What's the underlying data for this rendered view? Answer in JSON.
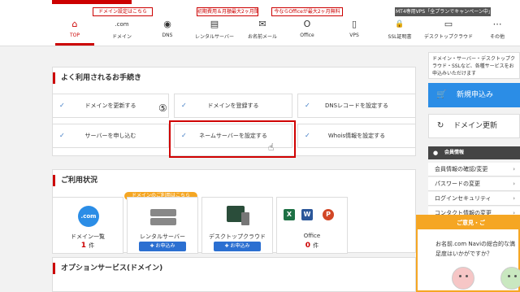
{
  "promos": [
    "ドメイン設定はこちら",
    "初期費用＆月額最大2ヶ月間無料！",
    "今ならOfficeが最大2ヶ月無料",
    "MT4専用VPS「全プランでキャンペーン中」"
  ],
  "nav": [
    {
      "label": "TOP",
      "icon": "home-icon",
      "glyph": "⌂"
    },
    {
      "label": "ドメイン",
      "icon": "domain-icon",
      "glyph": ".com"
    },
    {
      "label": "DNS",
      "icon": "dns-icon",
      "glyph": "◉"
    },
    {
      "label": "レンタルサーバー",
      "icon": "server-icon",
      "glyph": "▤"
    },
    {
      "label": "お名前メール",
      "icon": "mail-icon",
      "glyph": "✉"
    },
    {
      "label": "Office",
      "icon": "office-icon",
      "glyph": "O"
    },
    {
      "label": "VPS",
      "icon": "vps-icon",
      "glyph": "▯"
    },
    {
      "label": "SSL証明書",
      "icon": "lock-icon",
      "glyph": "🔒"
    },
    {
      "label": "デスクトップクラウド",
      "icon": "desktop-icon",
      "glyph": "▭"
    },
    {
      "label": "その他",
      "icon": "more-icon",
      "glyph": "⋯"
    }
  ],
  "procedures": {
    "title": "よく利用されるお手続き",
    "items": [
      "ドメインを更新する",
      "ドメインを登録する",
      "DNSレコードを設定する",
      "サーバーを申し込む",
      "ネームサーバーを設定する",
      "Whois情報を設定する"
    ],
    "step_marker": "⑤"
  },
  "usage": {
    "title": "ご利用状況",
    "pill": "ドメインのご利用はこちら",
    "cards": [
      {
        "label": "ドメイン一覧",
        "count": "1",
        "unit": "件",
        "icon_text": ".com"
      },
      {
        "label": "レンタルサーバー",
        "button": "✚ お申込み"
      },
      {
        "label": "デスクトップクラウド",
        "button": "✚ お申込み"
      },
      {
        "label": "Office",
        "count": "0",
        "unit": "件"
      }
    ]
  },
  "options": {
    "title": "オプションサービス(ドメイン)"
  },
  "sidebar": {
    "note": "ドメイン・サーバー・デスクトップクラウド・SSLなど、各種サービスをお申込みいただけます",
    "apply": "新規申込み",
    "renew": "ドメイン更新",
    "member_title": "会員情報",
    "member_links": [
      "会員情報の確認/変更",
      "パスワードの変更",
      "ログインセキュリティ",
      "コンタクト情報の変更"
    ]
  },
  "survey": {
    "title": "ご意見・ご",
    "text": "お名前.com Naviの総合的な満足度はいかがですか？"
  },
  "colors": {
    "brand_red": "#cc0000",
    "accent_blue": "#2b8de6",
    "survey_orange": "#f5a623"
  }
}
